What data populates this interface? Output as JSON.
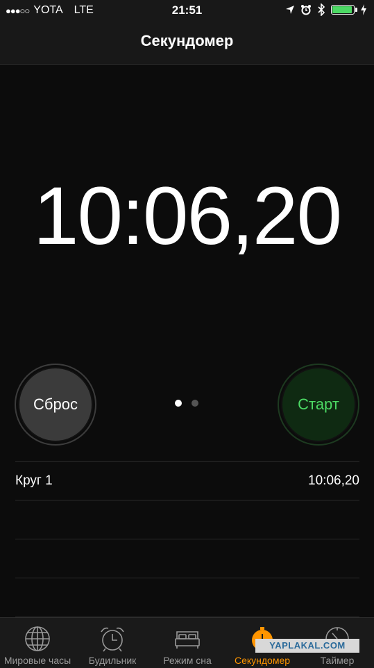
{
  "status_bar": {
    "carrier": "YOTA",
    "network": "LTE",
    "time": "21:51",
    "battery_level": 0.95,
    "icons": [
      "location-icon",
      "alarm-icon",
      "bluetooth-icon",
      "battery-icon",
      "charging-icon"
    ]
  },
  "nav": {
    "title": "Секундомер"
  },
  "stopwatch": {
    "time": "10:06,20"
  },
  "buttons": {
    "reset_label": "Сброс",
    "start_label": "Старт"
  },
  "laps": [
    {
      "label": "Круг 1",
      "time": "10:06,20"
    },
    {
      "label": "",
      "time": ""
    },
    {
      "label": "",
      "time": ""
    },
    {
      "label": "",
      "time": ""
    }
  ],
  "tabs": [
    {
      "label": "Мировые часы",
      "icon": "globe-icon"
    },
    {
      "label": "Будильник",
      "icon": "alarm-clock-icon"
    },
    {
      "label": "Режим сна",
      "icon": "bed-icon"
    },
    {
      "label": "Секундомер",
      "icon": "stopwatch-icon",
      "active": true
    },
    {
      "label": "Таймер",
      "icon": "timer-icon"
    }
  ],
  "watermark": "YAPLAKAL.COM",
  "colors": {
    "accent": "#ff9500",
    "start_green": "#4cd964",
    "background": "#0c0c0c"
  }
}
